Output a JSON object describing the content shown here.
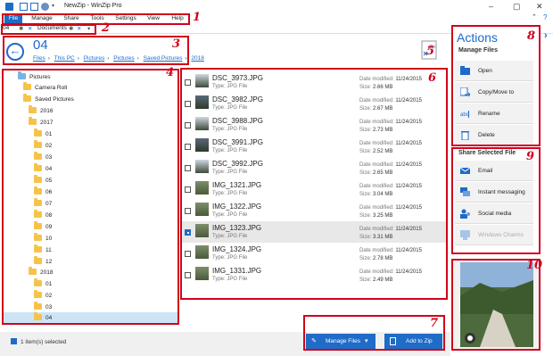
{
  "window": {
    "title": "NewZip - WinZip Pro"
  },
  "menu": {
    "items": [
      "File",
      "Manage",
      "Share",
      "Tools",
      "Settings",
      "View",
      "Help"
    ]
  },
  "tabs": {
    "path_fragment": "04",
    "tab_label": "Documents"
  },
  "header": {
    "folder_title": "04",
    "breadcrumb": [
      "Files",
      "This PC",
      "Pictures",
      "Pictures",
      "Saved Pictures",
      "2018"
    ]
  },
  "tree": {
    "items": [
      {
        "label": "Pictures",
        "type": "pictures"
      },
      {
        "label": "Camera Roll",
        "type": "folder"
      },
      {
        "label": "Saved Pictures",
        "type": "folder"
      },
      {
        "label": "2016",
        "type": "folder"
      },
      {
        "label": "2017",
        "type": "folder"
      },
      {
        "label": "01",
        "type": "folder"
      },
      {
        "label": "02",
        "type": "folder"
      },
      {
        "label": "03",
        "type": "folder"
      },
      {
        "label": "04",
        "type": "folder"
      },
      {
        "label": "05",
        "type": "folder"
      },
      {
        "label": "06",
        "type": "folder"
      },
      {
        "label": "07",
        "type": "folder"
      },
      {
        "label": "08",
        "type": "folder"
      },
      {
        "label": "09",
        "type": "folder"
      },
      {
        "label": "10",
        "type": "folder"
      },
      {
        "label": "11",
        "type": "folder"
      },
      {
        "label": "12",
        "type": "folder"
      },
      {
        "label": "2018",
        "type": "folder"
      },
      {
        "label": "01",
        "type": "folder"
      },
      {
        "label": "02",
        "type": "folder"
      },
      {
        "label": "03",
        "type": "folder"
      },
      {
        "label": "04",
        "type": "folder"
      }
    ]
  },
  "files": {
    "modified_label": "Date modified:",
    "size_label": "Size:",
    "type_label": "Type:",
    "rows": [
      {
        "name": "DSC_3973.JPG",
        "type": "JPG File",
        "modified": "11/24/2015",
        "size": "2.66 MB",
        "selected": false
      },
      {
        "name": "DSC_3982.JPG",
        "type": "JPG File",
        "modified": "11/24/2015",
        "size": "2.67 MB",
        "selected": false
      },
      {
        "name": "DSC_3988.JPG",
        "type": "JPG File",
        "modified": "11/24/2015",
        "size": "2.73 MB",
        "selected": false
      },
      {
        "name": "DSC_3991.JPG",
        "type": "JPG File",
        "modified": "11/24/2015",
        "size": "2.52 MB",
        "selected": false
      },
      {
        "name": "DSC_3992.JPG",
        "type": "JPG File",
        "modified": "11/24/2015",
        "size": "2.65 MB",
        "selected": false
      },
      {
        "name": "IMG_1321.JPG",
        "type": "JPG File",
        "modified": "11/24/2015",
        "size": "3.04 MB",
        "selected": false
      },
      {
        "name": "IMG_1322.JPG",
        "type": "JPG File",
        "modified": "11/24/2015",
        "size": "3.25 MB",
        "selected": false
      },
      {
        "name": "IMG_1323.JPG",
        "type": "JPG File",
        "modified": "11/24/2015",
        "size": "3.31 MB",
        "selected": true
      },
      {
        "name": "IMG_1324.JPG",
        "type": "JPG File",
        "modified": "11/24/2015",
        "size": "2.78 MB",
        "selected": false
      },
      {
        "name": "IMG_1331.JPG",
        "type": "JPG File",
        "modified": "11/24/2015",
        "size": "2.49 MB",
        "selected": false
      }
    ]
  },
  "zip_icon_label": "Zip",
  "actions": {
    "title": "Actions",
    "manage_title": "Manage Files",
    "manage": [
      {
        "label": "Open",
        "icon": "open-icon"
      },
      {
        "label": "Copy/Move to",
        "icon": "copy-move-icon"
      },
      {
        "label": "Rename",
        "icon": "rename-icon"
      },
      {
        "label": "Delete",
        "icon": "delete-icon"
      }
    ],
    "share_title": "Share Selected File",
    "share": [
      {
        "label": "Email",
        "icon": "email-icon",
        "disabled": false
      },
      {
        "label": "Instant messaging",
        "icon": "instant-messaging-icon",
        "disabled": false
      },
      {
        "label": "Social media",
        "icon": "social-media-icon",
        "disabled": false
      },
      {
        "label": "Windows Charms",
        "icon": "windows-charms-icon",
        "disabled": true
      }
    ]
  },
  "status": {
    "text": "1 item(s) selected"
  },
  "bottom": {
    "manage_files": "Manage Files",
    "add_to_zip": "Add to Zip"
  },
  "annotations": [
    "1",
    "2",
    "3",
    "4",
    "5",
    "6",
    "7",
    "8",
    "9",
    "10"
  ],
  "colors": {
    "accent": "#1e6bc8",
    "annotation": "#d0021b",
    "folder": "#f6c34a"
  }
}
